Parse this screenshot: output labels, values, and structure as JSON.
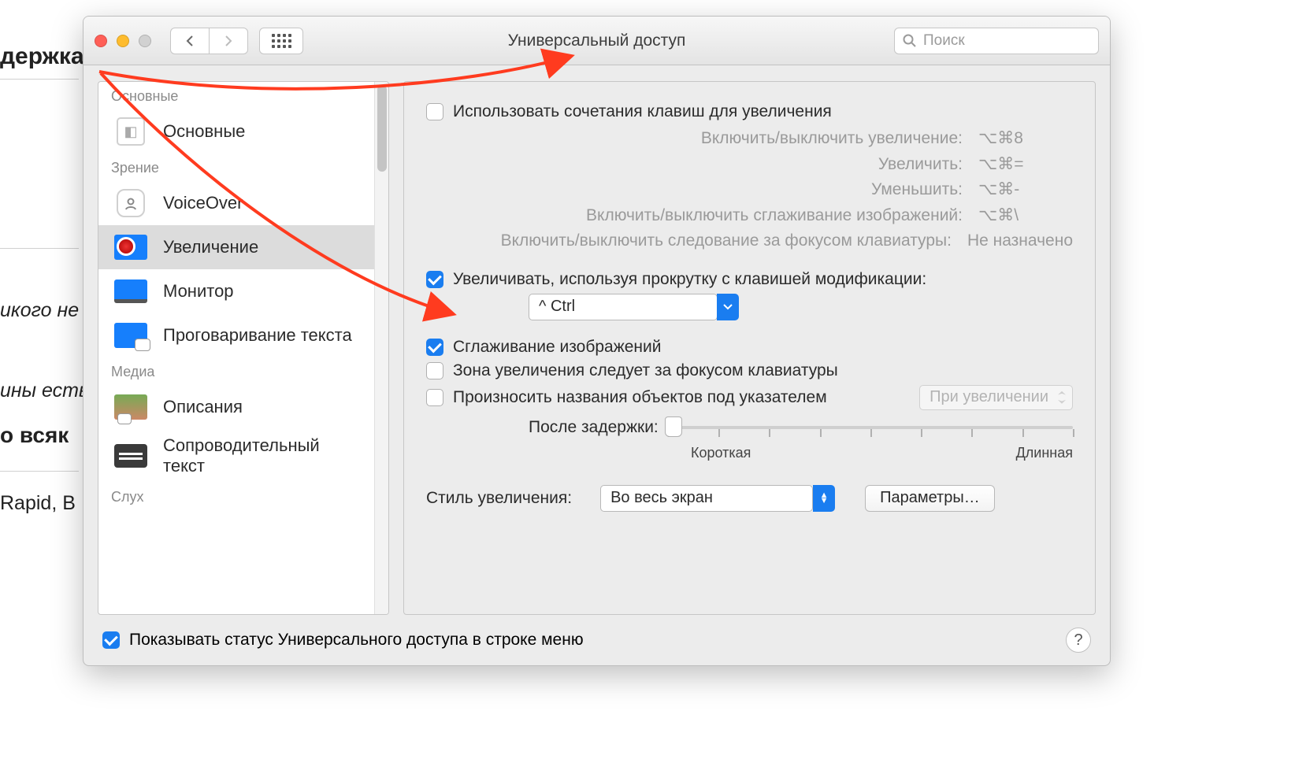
{
  "bg": {
    "t1": "держка",
    "t3": "икого не",
    "t4": "ины есть",
    "t5": "о всяк",
    "t6": "Rapid, B"
  },
  "window": {
    "title": "Универсальный доступ",
    "search_placeholder": "Поиск"
  },
  "sidebar": {
    "cat_general": "Основные",
    "general": "Основные",
    "cat_vision": "Зрение",
    "voiceover": "VoiceOver",
    "zoom": "Увеличение",
    "display": "Монитор",
    "speech": "Проговаривание текста",
    "cat_media": "Медиа",
    "descriptions": "Описания",
    "captions": "Сопроводительный текст",
    "cat_hearing": "Слух"
  },
  "panel": {
    "use_shortcuts": "Использовать сочетания клавиш для увеличения",
    "kb": {
      "toggle_zoom_l": "Включить/выключить увеличение:",
      "toggle_zoom_k": "⌥⌘8",
      "zoom_in_l": "Увеличить:",
      "zoom_in_k": "⌥⌘=",
      "zoom_out_l": "Уменьшить:",
      "zoom_out_k": "⌥⌘-",
      "smooth_l": "Включить/выключить сглаживание изображений:",
      "smooth_k": "⌥⌘\\",
      "follow_l": "Включить/выключить следование за фокусом клавиатуры:",
      "follow_k": "Не назначено"
    },
    "scroll_zoom": "Увеличивать, используя прокрутку с клавишей модификации:",
    "modifier": "^ Ctrl",
    "smooth_images": "Сглаживание изображений",
    "follow_focus": "Зона увеличения следует за фокусом клавиатуры",
    "speak_items": "Произносить названия объектов под указателем",
    "when_zoomed": "При увеличении",
    "after_delay": "После задержки:",
    "short": "Короткая",
    "long": "Длинная",
    "zoom_style_l": "Стиль увеличения:",
    "zoom_style_v": "Во весь экран",
    "options": "Параметры…"
  },
  "footer": {
    "show_status": "Показывать статус Универсального доступа в строке меню"
  }
}
